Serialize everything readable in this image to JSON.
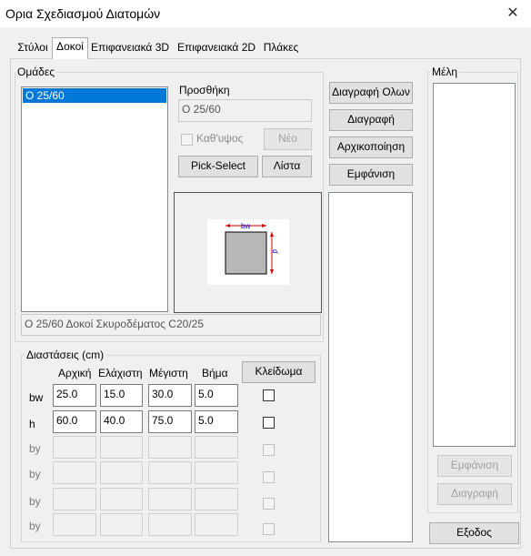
{
  "window": {
    "title": "Ορια Σχεδιασμού Διατομών",
    "close_glyph": "✕"
  },
  "tabs": [
    {
      "label": "Στύλοι"
    },
    {
      "label": "Δοκοί"
    },
    {
      "label": "Επιφανειακά 3D"
    },
    {
      "label": "Επιφανειακά 2D"
    },
    {
      "label": "Πλάκες"
    }
  ],
  "groups_box": {
    "label": "Ομάδες",
    "items": [
      "Ο 25/60"
    ],
    "description": "Ο 25/60 Δοκοί Σκυροδέματος C20/25"
  },
  "add_box": {
    "label": "Προσθήκη",
    "name_value": "Ο 25/60",
    "vertical_label": "Καθ'υψος",
    "new_button": "Νέο",
    "pick_button": "Pick-Select",
    "list_button": "Λίστα"
  },
  "preview": {
    "bw_label": "bw",
    "d_label": "d"
  },
  "actions": {
    "delete_all": "Διαγραφή Ολων",
    "delete": "Διαγραφή",
    "initialize": "Αρχικοποίηση",
    "show": "Εμφάνιση"
  },
  "members": {
    "label": "Μέλη",
    "show_button": "Εμφάνιση",
    "delete_button": "Διαγραφή"
  },
  "dimensions": {
    "label": "Διαστάσεις (cm)",
    "headers": {
      "initial": "Αρχική",
      "min": "Ελάχιστη",
      "max": "Μέγιστη",
      "step": "Βήμα"
    },
    "lock_button": "Κλείδωμα",
    "rows": [
      {
        "name": "bw",
        "initial": "25.0",
        "min": "15.0",
        "max": "30.0",
        "step": "5.0",
        "enabled": true
      },
      {
        "name": "h",
        "initial": "60.0",
        "min": "40.0",
        "max": "75.0",
        "step": "5.0",
        "enabled": true
      },
      {
        "name": "by",
        "initial": "",
        "min": "",
        "max": "",
        "step": "",
        "enabled": false
      },
      {
        "name": "by",
        "initial": "",
        "min": "",
        "max": "",
        "step": "",
        "enabled": false
      },
      {
        "name": "by",
        "initial": "",
        "min": "",
        "max": "",
        "step": "",
        "enabled": false
      },
      {
        "name": "by",
        "initial": "",
        "min": "",
        "max": "",
        "step": "",
        "enabled": false
      }
    ]
  },
  "exit_button": "Εξοδος",
  "colors": {
    "selection": "#0078d7",
    "dimension_arrow_red": "#d00000",
    "dimension_text_blue": "#0000c0"
  }
}
